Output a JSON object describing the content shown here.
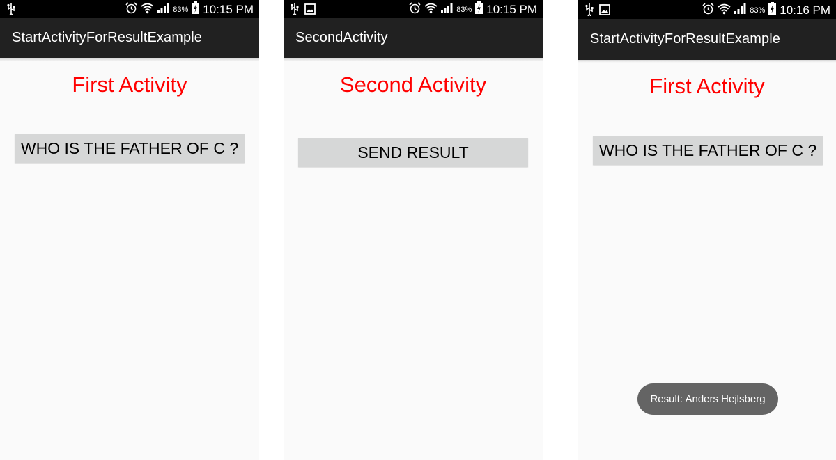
{
  "colors": {
    "status_bar": "#000000",
    "action_bar": "#212121",
    "heading_red": "#ff0000",
    "button_gray": "#d6d7d7",
    "toast_gray": "#646464",
    "screen_bg": "#fafafa"
  },
  "screens": [
    {
      "status": {
        "left_icons": [
          "usb-icon"
        ],
        "right_icons": [
          "alarm-icon",
          "wifi-icon",
          "signal-icon",
          "battery-charging-icon"
        ],
        "battery": "83%",
        "time": "10:15 PM"
      },
      "app_title": "StartActivityForResultExample",
      "heading": "First Activity",
      "button_label": "WHO IS THE FATHER OF C ?"
    },
    {
      "status": {
        "left_icons": [
          "usb-icon",
          "image-icon"
        ],
        "right_icons": [
          "alarm-icon",
          "wifi-icon",
          "signal-icon",
          "battery-charging-icon"
        ],
        "battery": "83%",
        "time": "10:15 PM"
      },
      "app_title": "SecondActivity",
      "heading": "Second Activity",
      "button_label": "SEND RESULT"
    },
    {
      "status": {
        "left_icons": [
          "usb-icon",
          "image-icon"
        ],
        "right_icons": [
          "alarm-icon",
          "wifi-icon",
          "signal-icon",
          "battery-charging-icon"
        ],
        "battery": "83%",
        "time": "10:16 PM"
      },
      "app_title": "StartActivityForResultExample",
      "heading": "First Activity",
      "button_label": "WHO IS THE FATHER OF C ?",
      "toast": "Result: Anders Hejlsberg"
    }
  ]
}
